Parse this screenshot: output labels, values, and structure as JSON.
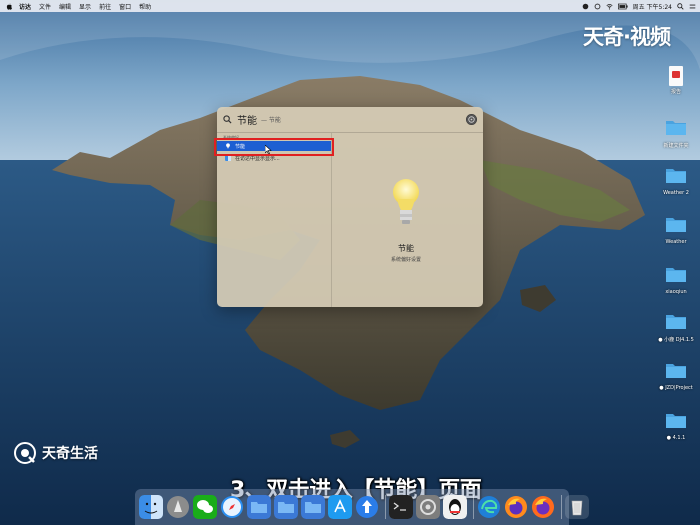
{
  "menubar": {
    "app_name": "访达",
    "menus": [
      "文件",
      "编辑",
      "显示",
      "前往",
      "窗口",
      "帮助"
    ],
    "clock": "周五 下午5:24"
  },
  "watermark": {
    "brand_top": "天奇·视频",
    "brand_bottom": "天奇生活"
  },
  "caption": "3、双击进入【节能】页面",
  "desktop_icons": [
    {
      "label": "报告"
    },
    {
      "label": "新建文件夹"
    },
    {
      "label": "Weather 2"
    },
    {
      "label": "Weather"
    },
    {
      "label": "xiaoqiun"
    },
    {
      "label": "● 小鹿 DJ4.1.5"
    },
    {
      "label": "● JZD|Project"
    },
    {
      "label": "● 4.1.1"
    }
  ],
  "spotlight": {
    "query": "节能",
    "hint": "— 节能",
    "section_label": "系统偏好",
    "results": [
      {
        "label": "节能",
        "selected": true
      },
      {
        "label": "在访达中显示显示..."
      }
    ],
    "preview": {
      "title": "节能",
      "subtitle": "系统偏好设置"
    }
  },
  "dock": {
    "items": [
      "finder-icon",
      "launchpad-icon",
      "wechat-icon",
      "safari-icon",
      "folder-icon",
      "folder-icon",
      "folder-icon",
      "app-store-icon",
      "upload-icon",
      "terminal-icon",
      "system-preferences-icon",
      "qq-icon",
      "edge-icon",
      "firefox-icon",
      "firefox-icon",
      "trash-icon"
    ]
  },
  "colors": {
    "selection": "#1d5fd2",
    "highlight_box": "#e02020",
    "spotlight_bg": "#d6ccb6"
  }
}
